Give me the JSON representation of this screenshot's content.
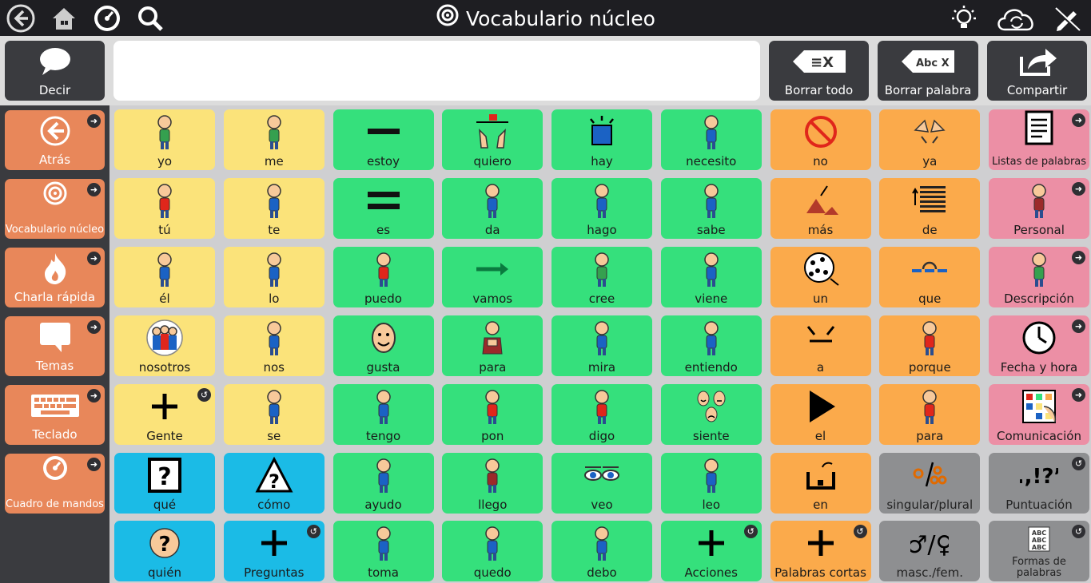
{
  "header": {
    "title": "Vocabulario núcleo",
    "left_icons": [
      "back-icon",
      "home-icon",
      "dashboard-icon",
      "search-icon"
    ],
    "right_icons": [
      "lightbulb-icon",
      "cloud-sync-icon",
      "edit-icon"
    ]
  },
  "actionbar": {
    "speak": "Decir",
    "clear_all": "Borrar todo",
    "clear_word": "Borrar palabra",
    "share": "Compartir",
    "clear_all_glyph": "≡X",
    "clear_word_glyph": "Abc X"
  },
  "sidebar": [
    {
      "label": "Atrás",
      "icon": "back-arrow-icon"
    },
    {
      "label": "Vocabulario núcleo",
      "icon": "target-icon"
    },
    {
      "label": "Charla rápida",
      "icon": "flame-icon"
    },
    {
      "label": "Temas",
      "icon": "speech-bubble-icon"
    },
    {
      "label": "Teclado",
      "icon": "keyboard-icon"
    },
    {
      "label": "Cuadro de mandos",
      "icon": "dashboard-icon"
    }
  ],
  "colors": {
    "pronoun": "#fbe37a",
    "verb": "#35e07c",
    "particle": "#fbaa4b",
    "category": "#ec8fa5",
    "question": "#1bbbe6",
    "grammar": "#8e8f91",
    "sidebar": "#e8875a"
  },
  "grid": [
    [
      {
        "l": "yo",
        "c": "y",
        "i": "person-self-icon"
      },
      {
        "l": "me",
        "c": "y",
        "i": "person-self-icon"
      },
      {
        "l": "estoy",
        "c": "g",
        "i": "dash-icon"
      },
      {
        "l": "quiero",
        "c": "g",
        "i": "want-icon"
      },
      {
        "l": "hay",
        "c": "g",
        "i": "exists-icon"
      },
      {
        "l": "necesito",
        "c": "g",
        "i": "need-icon"
      },
      {
        "l": "no",
        "c": "o",
        "i": "no-sign-icon"
      },
      {
        "l": "ya",
        "c": "o",
        "i": "hands-icon"
      },
      {
        "l": "Listas de palabras",
        "c": "p",
        "i": "notepad-icon",
        "arrow": true
      }
    ],
    [
      {
        "l": "tú",
        "c": "y",
        "i": "you-icon"
      },
      {
        "l": "te",
        "c": "y",
        "i": "pointing-icon"
      },
      {
        "l": "es",
        "c": "g",
        "i": "equals-icon"
      },
      {
        "l": "da",
        "c": "g",
        "i": "give-icon"
      },
      {
        "l": "hago",
        "c": "g",
        "i": "do-icon"
      },
      {
        "l": "sabe",
        "c": "g",
        "i": "know-icon"
      },
      {
        "l": "más",
        "c": "o",
        "i": "more-icon"
      },
      {
        "l": "de",
        "c": "o",
        "i": "of-icon"
      },
      {
        "l": "Personal",
        "c": "p",
        "i": "person-icon",
        "arrow": true
      }
    ],
    [
      {
        "l": "él",
        "c": "y",
        "i": "he-icon"
      },
      {
        "l": "lo",
        "c": "y",
        "i": "it-icon"
      },
      {
        "l": "puedo",
        "c": "g",
        "i": "can-icon"
      },
      {
        "l": "vamos",
        "c": "g",
        "i": "arrow-right-icon"
      },
      {
        "l": "cree",
        "c": "g",
        "i": "think-icon"
      },
      {
        "l": "viene",
        "c": "g",
        "i": "come-icon"
      },
      {
        "l": "un",
        "c": "o",
        "i": "dots-icon"
      },
      {
        "l": "que",
        "c": "o",
        "i": "that-icon"
      },
      {
        "l": "Descripción",
        "c": "p",
        "i": "description-icon",
        "arrow": true
      }
    ],
    [
      {
        "l": "nosotros",
        "c": "y",
        "i": "we-icon"
      },
      {
        "l": "nos",
        "c": "y",
        "i": "us-icon"
      },
      {
        "l": "gusta",
        "c": "g",
        "i": "like-icon"
      },
      {
        "l": "para",
        "c": "g",
        "i": "stop-icon"
      },
      {
        "l": "mira",
        "c": "g",
        "i": "look-icon"
      },
      {
        "l": "entiendo",
        "c": "g",
        "i": "understand-icon"
      },
      {
        "l": "a",
        "c": "o",
        "i": "to-icon"
      },
      {
        "l": "porque",
        "c": "o",
        "i": "because-icon"
      },
      {
        "l": "Fecha y hora",
        "c": "p",
        "i": "clock-icon",
        "arrow": true
      }
    ],
    [
      {
        "l": "Gente",
        "c": "y",
        "i": "plus-icon",
        "undo": true
      },
      {
        "l": "se",
        "c": "y",
        "i": "self-icon"
      },
      {
        "l": "tengo",
        "c": "g",
        "i": "have-icon"
      },
      {
        "l": "pon",
        "c": "g",
        "i": "put-icon"
      },
      {
        "l": "digo",
        "c": "g",
        "i": "say-icon"
      },
      {
        "l": "siente",
        "c": "g",
        "i": "feel-icon"
      },
      {
        "l": "el",
        "c": "o",
        "i": "play-triangle-icon"
      },
      {
        "l": "para",
        "c": "o",
        "i": "for-icon"
      },
      {
        "l": "Comunicación",
        "c": "p",
        "i": "board-icon",
        "arrow": true
      }
    ],
    [
      {
        "l": "qué",
        "c": "b",
        "i": "question-box-icon"
      },
      {
        "l": "cómo",
        "c": "b",
        "i": "question-triangle-icon"
      },
      {
        "l": "ayudo",
        "c": "g",
        "i": "help-icon"
      },
      {
        "l": "llego",
        "c": "g",
        "i": "arrive-icon"
      },
      {
        "l": "veo",
        "c": "g",
        "i": "eyes-icon"
      },
      {
        "l": "leo",
        "c": "g",
        "i": "read-icon"
      },
      {
        "l": "en",
        "c": "o",
        "i": "in-icon"
      },
      {
        "l": "singular/plural",
        "c": "gr",
        "i": "singular-plural-icon"
      },
      {
        "l": "Puntuación",
        "c": "gr",
        "i": "punctuation-icon",
        "undo": true
      }
    ],
    [
      {
        "l": "quién",
        "c": "b",
        "i": "question-head-icon"
      },
      {
        "l": "Preguntas",
        "c": "b",
        "i": "plus-icon",
        "undo": true
      },
      {
        "l": "toma",
        "c": "g",
        "i": "take-icon"
      },
      {
        "l": "quedo",
        "c": "g",
        "i": "stay-icon"
      },
      {
        "l": "debo",
        "c": "g",
        "i": "must-icon"
      },
      {
        "l": "Acciones",
        "c": "g",
        "i": "plus-icon",
        "undo": true
      },
      {
        "l": "Palabras cortas",
        "c": "o",
        "i": "plus-icon",
        "undo": true
      },
      {
        "l": "masc./fem.",
        "c": "gr",
        "i": "gender-icon"
      },
      {
        "l": "Formas de palabras",
        "c": "gr",
        "i": "word-forms-icon",
        "undo": true
      }
    ]
  ]
}
